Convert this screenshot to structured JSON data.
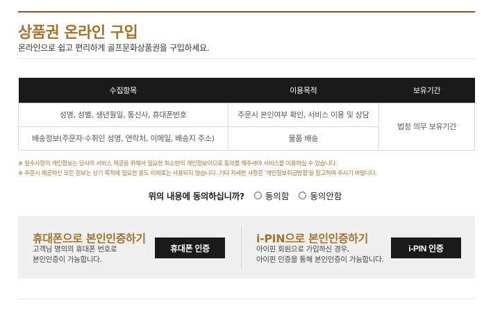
{
  "header": {
    "title": "상품권 온라인 구입",
    "subtitle": "온라인으로 쉽고 편리하게 골프문화상품권을 구입하세요."
  },
  "terms_table": {
    "headers": [
      "수집항목",
      "이용목적",
      "보유기간"
    ],
    "rows": [
      {
        "item": "성명, 성별, 생년월일, 통신사, 휴대폰번호",
        "purpose": "주문시 본인여부 확인, 서비스 이용 및 상담"
      },
      {
        "item": "배송정보(주문자·수취인 성명, 연락처, 이메일, 배송지 주소)",
        "purpose": "물품 배송"
      }
    ],
    "retention": "법정 의무 보유기간"
  },
  "notes": [
    "※ 필수사항의 개인정보는 당사의 서비스 제공을 위해서 필요한 최소한의 개인정보이므로 동의를 해주셔야 서비스를 이용하실 수 있습니다.",
    "※ 주문시 제공하신 모든 정보는 상기 목적에 필요한 용도 이외로는 사용되지 않습니다. 기타 자세한 사항은 '개인정보취급방침'을 참고하여 주시기 바랍니다."
  ],
  "consent": {
    "question": "위의 내용에 동의하십니까?",
    "agree": "동의함",
    "disagree": "동의안함"
  },
  "verify": {
    "phone": {
      "title": "휴대폰으로 본인인증하기",
      "desc1": "고객님 명의의 휴대폰 번호로",
      "desc2": "본인인증이 가능합니다.",
      "button": "휴대폰 인증"
    },
    "ipin": {
      "title": "i-PIN으로 본인인증하기",
      "desc1": "아이핀 회원으로 가입하신 경우,",
      "desc2": "아이핀 인증을 통해 본인인증이 가능합니다.",
      "button": "i-PIN 인증"
    }
  },
  "colors": {
    "accent": "#a0742e",
    "dark": "#1a1a1a",
    "panel": "#f0f0f0"
  }
}
